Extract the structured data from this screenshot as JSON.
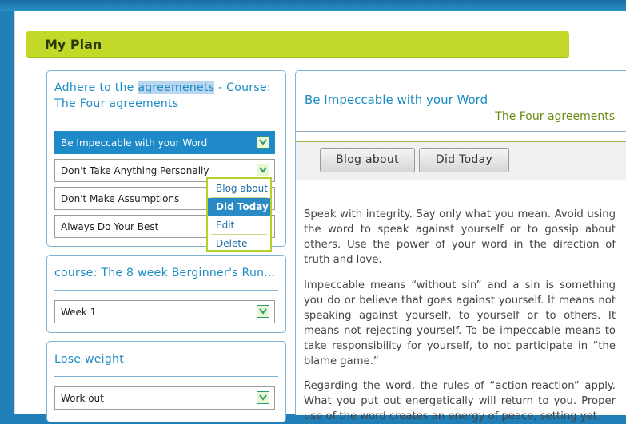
{
  "page_title": "My Plan",
  "plans": [
    {
      "title_before": "Adhere to the ",
      "title_highlight": "agreemenets",
      "title_after": " - Course:",
      "title_line2": "The Four agreements",
      "items": [
        "Be Impeccable with your Word",
        "Don't Take Anything Personally",
        "Don't Make Assumptions",
        "Always Do Your Best"
      ]
    },
    {
      "title": "course: The 8 week Berginner's Run...",
      "items": [
        "Week 1"
      ]
    },
    {
      "title": "Lose weight",
      "items": [
        "Work out"
      ]
    }
  ],
  "context_menu": {
    "items": [
      "Blog about",
      "Did Today",
      "Edit",
      "Delete"
    ],
    "selected": "Did Today"
  },
  "detail": {
    "title": "Be Impeccable with your Word",
    "course": "The Four agreements",
    "buttons": [
      "Blog about",
      "Did Today"
    ],
    "paragraphs": [
      "Speak with integrity.  Say only what you mean.  Avoid using the word to speak against yourself or to gossip about others.  Use the power of your word in the direction of truth and love.",
      "Impeccable means “without sin” and a sin is something you do or believe that goes against yourself.  It means not speaking against yourself, to yourself or to others.  It means not rejecting yourself.  To be impeccable means to take responsibility for yourself, to not participate in “the blame game.”",
      "Regarding the word, the rules of “action-reaction” apply.  What you put out energetically will return to you.  Proper use of the word creates an energy of peace, setting yet"
    ]
  },
  "colors": {
    "accent_blue": "#1b8bc4",
    "bar_green": "#c3d92a",
    "selected_row": "#1f8ac8"
  },
  "icons": {
    "dropdown": "chevron-down-icon"
  }
}
